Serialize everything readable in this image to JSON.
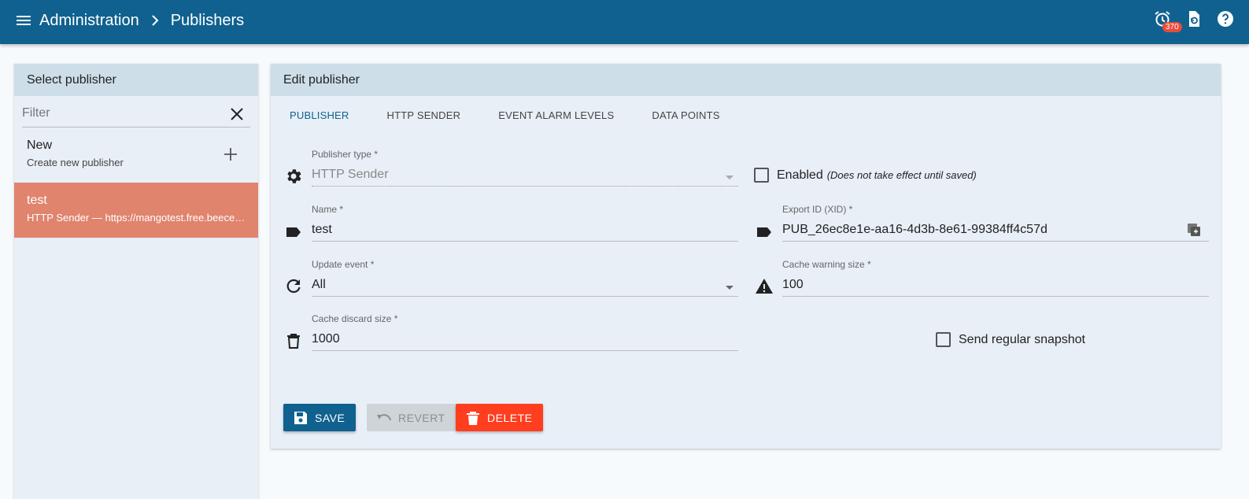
{
  "header": {
    "breadcrumb_root": "Administration",
    "breadcrumb_current": "Publishers",
    "alarm_count": "370"
  },
  "left_panel": {
    "title": "Select publisher",
    "filter_placeholder": "Filter",
    "new_item": {
      "title": "New",
      "subtitle": "Create new publisher"
    },
    "items": [
      {
        "title": "test",
        "subtitle": "HTTP Sender — https://mangotest.free.beeceptor.com"
      }
    ]
  },
  "edit_panel": {
    "title": "Edit publisher",
    "tabs": [
      "PUBLISHER",
      "HTTP SENDER",
      "EVENT ALARM LEVELS",
      "DATA POINTS"
    ],
    "fields": {
      "publisher_type": {
        "label": "Publisher type *",
        "value": "HTTP Sender"
      },
      "enabled": {
        "label": "Enabled",
        "note": "(Does not take effect until saved)"
      },
      "name": {
        "label": "Name *",
        "value": "test"
      },
      "xid": {
        "label": "Export ID (XID) *",
        "value": "PUB_26ec8e1e-aa16-4d3b-8e61-99384ff4c57d"
      },
      "update_event": {
        "label": "Update event *",
        "value": "All"
      },
      "cache_warning": {
        "label": "Cache warning size *",
        "value": "100"
      },
      "cache_discard": {
        "label": "Cache discard size *",
        "value": "1000"
      },
      "snapshot": {
        "label": "Send regular snapshot"
      }
    },
    "buttons": {
      "save": "SAVE",
      "revert": "REVERT",
      "delete": "DELETE"
    }
  },
  "colors": {
    "topbar": "#10618f",
    "selected_item": "#e0846e",
    "delete": "#ff3d1f",
    "save": "#10618f"
  }
}
